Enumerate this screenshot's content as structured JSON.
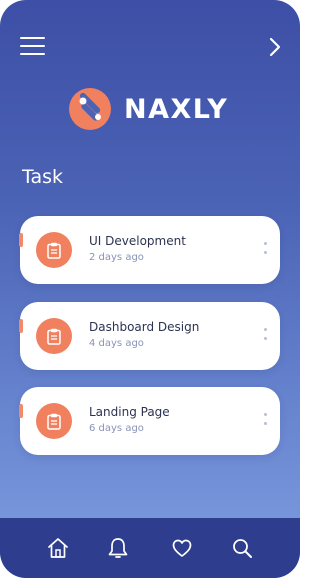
{
  "header": {
    "menu_icon": "hamburger-menu-icon",
    "next_icon": "chevron-right-icon"
  },
  "brand": {
    "name": "NAXLY",
    "logo_icon": "naxly-logo-mark",
    "logo_color": "#f1805f"
  },
  "section": {
    "title": "Task"
  },
  "tasks": [
    {
      "title": "UI Development",
      "time": "2 days ago",
      "icon": "clipboard-icon"
    },
    {
      "title": "Dashboard Design",
      "time": "4 days ago",
      "icon": "clipboard-icon"
    },
    {
      "title": "Landing Page",
      "time": "6 days ago",
      "icon": "clipboard-icon"
    }
  ],
  "bottom_nav": [
    {
      "icon": "home-icon"
    },
    {
      "icon": "bell-icon"
    },
    {
      "icon": "heart-icon"
    },
    {
      "icon": "search-icon"
    }
  ],
  "colors": {
    "accent": "#f1805f",
    "nav_background": "#2f3d8e",
    "gradient_top": "#3d4fa6",
    "gradient_bottom": "#7e9ee0"
  }
}
